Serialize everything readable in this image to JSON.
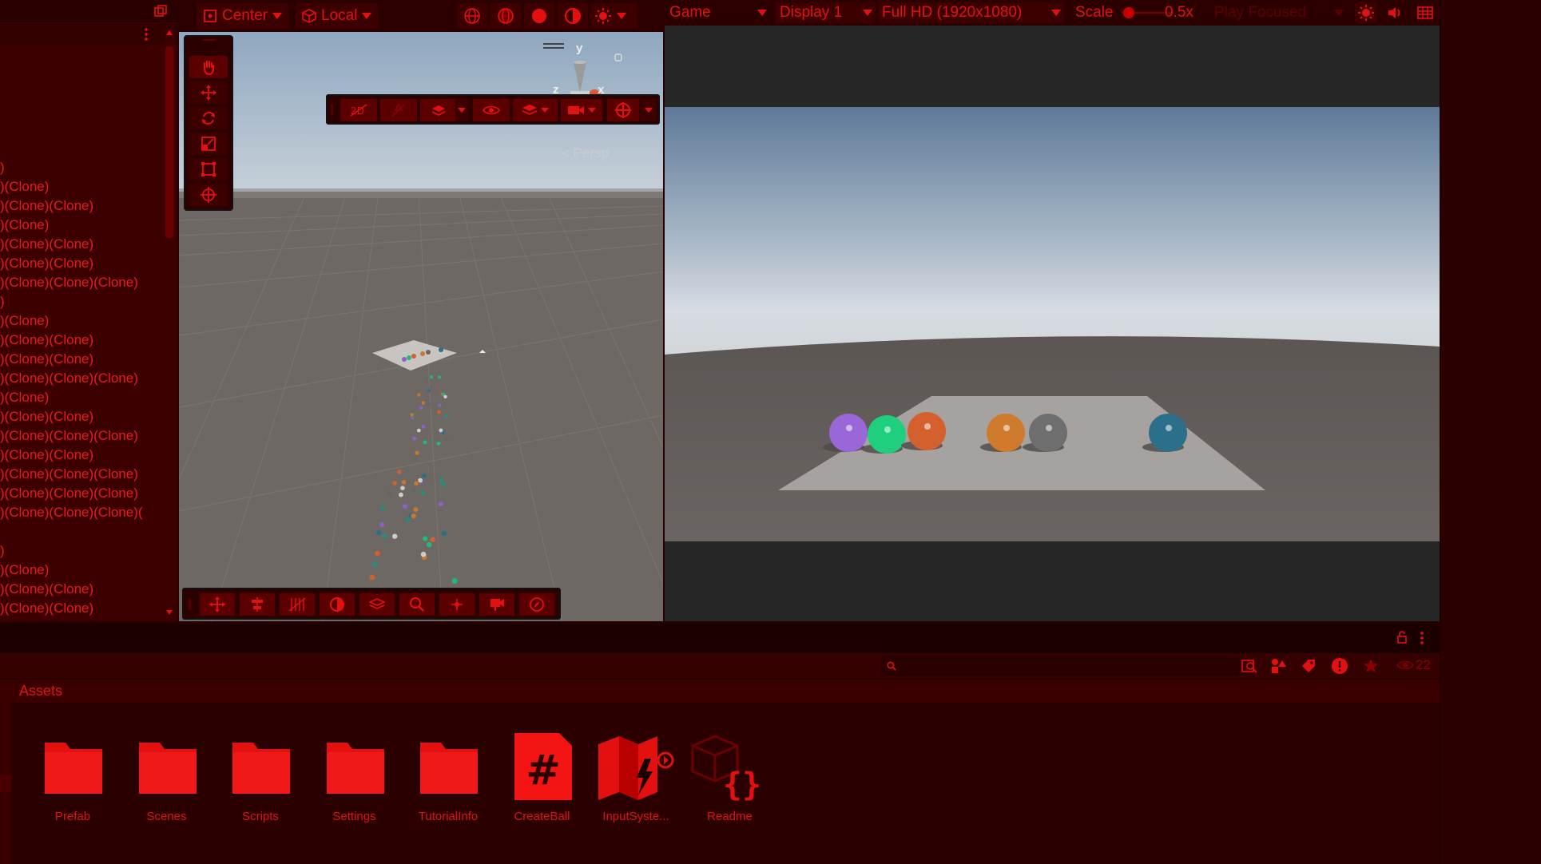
{
  "scene_toolbar": {
    "pivot_label": "Center",
    "space_label": "Local"
  },
  "scene_view": {
    "camera_mode": "Persp",
    "gizmo_axes": {
      "y": "y",
      "z": "z",
      "x": "x"
    }
  },
  "hierarchy": {
    "items": [
      ")",
      ")(Clone)",
      ")(Clone)(Clone)",
      ")(Clone)",
      ")(Clone)(Clone)",
      ")(Clone)(Clone)",
      ")(Clone)(Clone)(Clone)",
      ")",
      ")(Clone)",
      ")(Clone)(Clone)",
      ")(Clone)(Clone)",
      ")(Clone)(Clone)(Clone)",
      ")(Clone)",
      ")(Clone)(Clone)",
      ")(Clone)(Clone)(Clone)",
      ")(Clone)(Clone)",
      ")(Clone)(Clone)(Clone)",
      ")(Clone)(Clone)(Clone)",
      ")(Clone)(Clone)(Clone)(",
      "",
      ")",
      ")(Clone)",
      ")(Clone)(Clone)",
      ")(Clone)(Clone)"
    ]
  },
  "game_toolbar": {
    "view_label": "Game",
    "display_label": "Display 1",
    "resolution_label": "Full HD (1920x1080)",
    "scale_label": "Scale",
    "scale_value": "0.5x",
    "play_mode_label": "Play Focused"
  },
  "game_view": {
    "spheres": [
      {
        "name": "purple",
        "color": "#9a67d8"
      },
      {
        "name": "green",
        "color": "#1fcf7e"
      },
      {
        "name": "orange",
        "color": "#d4602e"
      },
      {
        "name": "amber",
        "color": "#cf7a2c"
      },
      {
        "name": "gray",
        "color": "#6e6e6e"
      },
      {
        "name": "teal",
        "color": "#2b6f8a"
      }
    ]
  },
  "project": {
    "breadcrumb": "Assets",
    "visible_count": "22",
    "assets": [
      {
        "label": "Prefab",
        "icon": "folder-icon"
      },
      {
        "label": "Scenes",
        "icon": "folder-icon"
      },
      {
        "label": "Scripts",
        "icon": "folder-icon"
      },
      {
        "label": "Settings",
        "icon": "folder-icon"
      },
      {
        "label": "TutorialInfo",
        "icon": "folder-icon"
      },
      {
        "label": "CreateBall",
        "icon": "csharp-script-icon"
      },
      {
        "label": "InputSyste...",
        "icon": "input-actions-icon"
      },
      {
        "label": "Readme",
        "icon": "readme-asset-icon"
      }
    ]
  },
  "colors": {
    "accent": "#e31010",
    "panel": "#2a0000",
    "panel_light": "#3d0000"
  }
}
